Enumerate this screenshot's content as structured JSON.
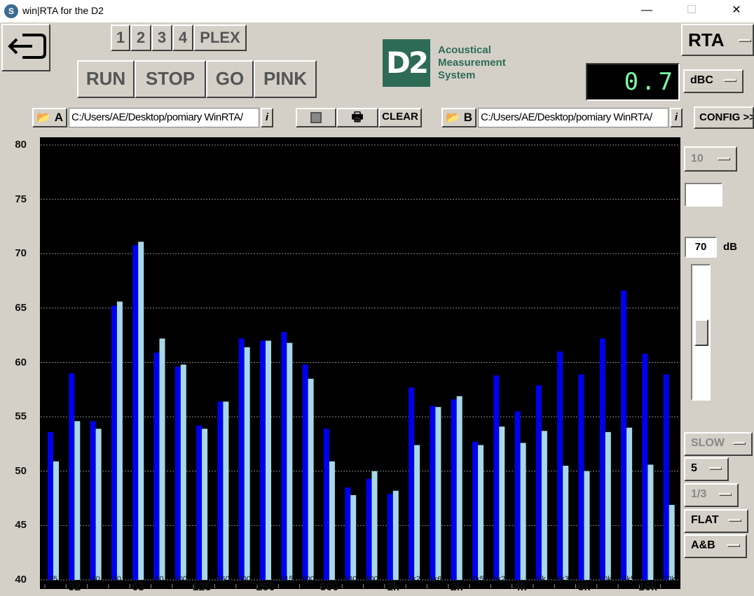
{
  "window": {
    "title": "win|RTA for the D2",
    "minimize": "—",
    "maximize": "☐",
    "close": "✕"
  },
  "toolbar": {
    "exit_icon": "exit-icon",
    "pages": [
      "1",
      "2",
      "3",
      "4"
    ],
    "plex": "PLEX",
    "run": "RUN",
    "stop": "STOP",
    "go": "GO",
    "pink": "PINK"
  },
  "logo": {
    "mark": "D2",
    "line1": "Acoustical",
    "line2": "Measurement",
    "line3": "System"
  },
  "mode": "RTA",
  "readout": {
    "value": "0.7",
    "weighting": "dBC"
  },
  "files": {
    "a_label": "A",
    "a_path": "C:/Users/AE/Desktop/pomiary WinRTA/",
    "b_label": "B",
    "b_path": "C:/Users/AE/Desktop/pomiary WinRTA/",
    "info": "i",
    "clear": "CLEAR",
    "config": "CONFIG >>"
  },
  "side": {
    "range": "10",
    "ref_level": "70",
    "ref_unit": "dB",
    "speed": "SLOW",
    "avg": "5",
    "resolution": "1/3",
    "weighting": "FLAT",
    "display": "A&B"
  },
  "chart_data": {
    "type": "bar",
    "ylim": [
      40,
      80
    ],
    "yticks": [
      80,
      75,
      70,
      65,
      60,
      55,
      50,
      45,
      40
    ],
    "grid": true,
    "categories": [
      "25",
      "32",
      "40",
      "50",
      "63",
      "80",
      "100",
      "125",
      "160",
      "200",
      "250",
      "315",
      "400",
      "500",
      "630",
      "800",
      "1k",
      "1k2",
      "1k6",
      "2k",
      "2k5",
      "3k2",
      "4k",
      "5k",
      "6k3",
      "8k",
      "10k",
      "12k5",
      "16k",
      "20k"
    ],
    "major_labels": [
      "32",
      "63",
      "125",
      "250",
      "500",
      "1k",
      "2k",
      "4k",
      "8k",
      "16k"
    ],
    "series": [
      {
        "name": "A",
        "color": "#0000ee",
        "values": [
          53.6,
          59.0,
          54.6,
          65.2,
          70.8,
          60.9,
          59.6,
          54.2,
          56.4,
          62.2,
          62.0,
          62.8,
          59.8,
          53.9,
          48.5,
          49.3,
          47.9,
          57.7,
          56.0,
          56.6,
          52.7,
          58.8,
          55.5,
          57.9,
          61.0,
          58.9,
          62.2,
          66.6,
          60.8,
          58.9
        ]
      },
      {
        "name": "B",
        "color": "#a8d8e8",
        "values": [
          50.9,
          54.6,
          53.9,
          65.6,
          71.1,
          62.2,
          59.8,
          53.9,
          56.4,
          61.4,
          62.0,
          61.8,
          58.5,
          50.9,
          47.8,
          50.0,
          48.2,
          52.4,
          55.9,
          56.9,
          52.4,
          54.1,
          52.6,
          53.7,
          50.5,
          50.0,
          53.6,
          54.0,
          50.6,
          46.9
        ]
      }
    ]
  }
}
